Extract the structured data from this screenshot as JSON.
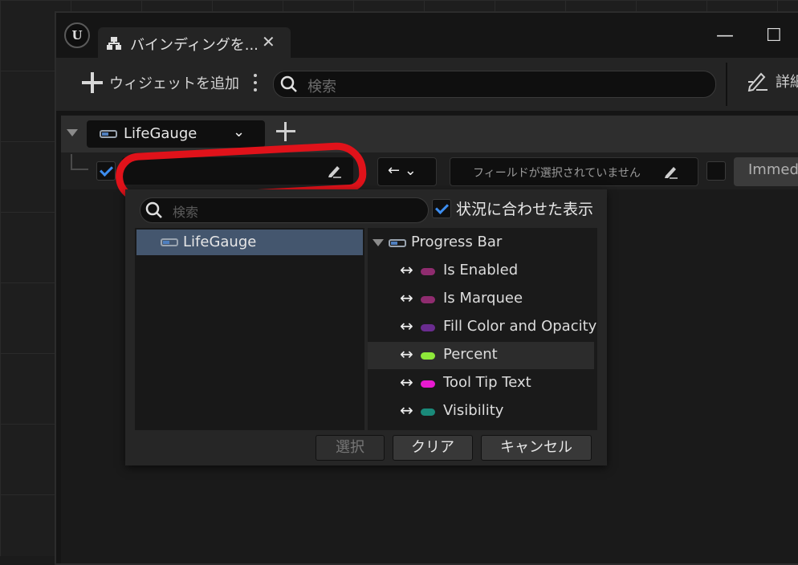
{
  "window": {
    "tab_title": "バインディングを...",
    "minimize_glyph": "—",
    "maximize_glyph": "☐"
  },
  "toolbar": {
    "add_widget_label": "ウィジェットを追加",
    "search_placeholder": "検索",
    "details_label": "詳細"
  },
  "binding": {
    "widget_name": "LifeGauge",
    "direction_label": "← ⌄",
    "field_placeholder": "フィールドが選択されていません",
    "immediate_label": "Immediate"
  },
  "popup": {
    "search_placeholder": "検索",
    "context_sensitive_label": "状況に合わせた表示",
    "left_tree": [
      {
        "label": "LifeGauge"
      }
    ],
    "right_root": "Progress Bar",
    "properties": [
      {
        "label": "Is Enabled",
        "color": "#8f2c6f"
      },
      {
        "label": "Is Marquee",
        "color": "#8f2c6f"
      },
      {
        "label": "Fill Color and Opacity",
        "color": "#6a2c8f"
      },
      {
        "label": "Percent",
        "color": "#8ee83a"
      },
      {
        "label": "Tool Tip Text",
        "color": "#e81ad0"
      },
      {
        "label": "Visibility",
        "color": "#1a8a7a"
      }
    ],
    "selected_property": "Percent",
    "buttons": {
      "select": "選択",
      "clear": "クリア",
      "cancel": "キャンセル"
    }
  },
  "icons": [
    "unreal-logo-icon",
    "widget-tree-icon",
    "close-icon",
    "plus-icon",
    "kebab-icon",
    "search-icon",
    "pencil-icon",
    "progress-bar-icon",
    "bidirectional-arrow-icon"
  ]
}
